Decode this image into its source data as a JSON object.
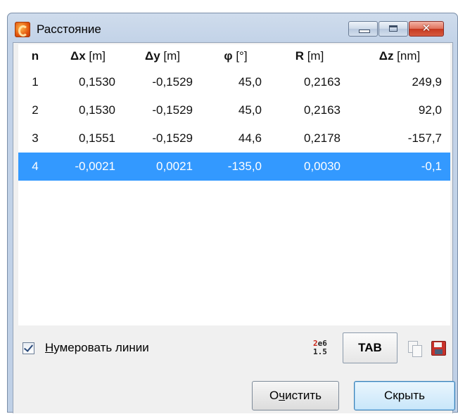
{
  "window": {
    "title": "Расстояние",
    "close_glyph": "✕"
  },
  "table": {
    "columns": [
      {
        "symbol": "n",
        "unit": ""
      },
      {
        "symbol": "Δx",
        "unit": " [m]"
      },
      {
        "symbol": "Δy",
        "unit": " [m]"
      },
      {
        "symbol": "φ",
        "unit": " [°]"
      },
      {
        "symbol": "R",
        "unit": " [m]"
      },
      {
        "symbol": "Δz",
        "unit": " [nm]"
      }
    ],
    "rows": [
      {
        "n": "1",
        "dx": "0,1530",
        "dy": "-0,1529",
        "phi": "45,0",
        "r": "0,2163",
        "dz": "249,9"
      },
      {
        "n": "2",
        "dx": "0,1530",
        "dy": "-0,1529",
        "phi": "45,0",
        "r": "0,2163",
        "dz": "92,0"
      },
      {
        "n": "3",
        "dx": "0,1551",
        "dy": "-0,1529",
        "phi": "44,6",
        "r": "0,2178",
        "dz": "-157,7"
      },
      {
        "n": "4",
        "dx": "-0,0021",
        "dy": "0,0021",
        "phi": "-135,0",
        "r": "0,0030",
        "dz": "-0,1"
      }
    ],
    "selected_row": 4,
    "selection_color": "#3399ff"
  },
  "footer": {
    "number_lines": {
      "checked": true,
      "label_mnemonic": "Н",
      "label_rest": "умеровать линии"
    },
    "format_icon": {
      "top_a": "2",
      "top_b": "e6",
      "bottom": "1.5"
    },
    "tab_button_label": "TAB",
    "copy_icon": "copy-icon",
    "save_icon": "save-icon",
    "clear_button": {
      "pre": "О",
      "mnemonic": "ч",
      "post": "истить"
    },
    "hide_button_label": "Скрыть"
  }
}
